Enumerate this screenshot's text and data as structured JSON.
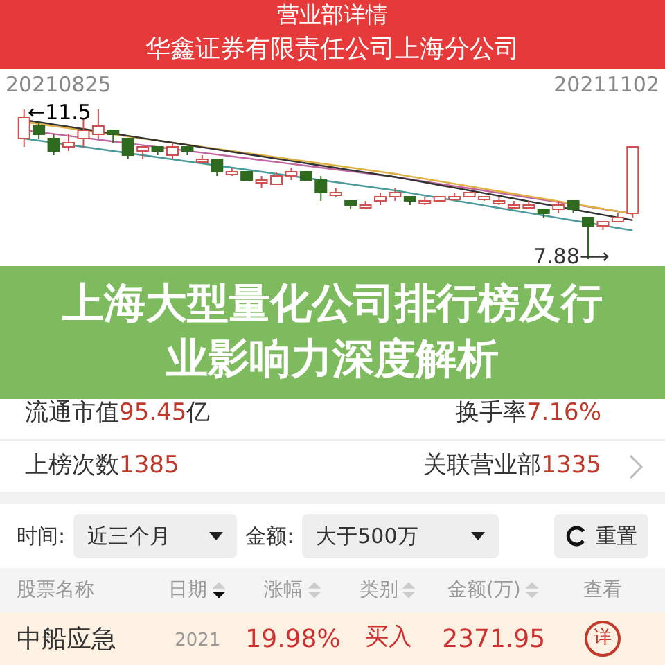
{
  "header": {
    "title": "营业部详情",
    "subtitle": "华鑫证券有限责任公司上海分公司"
  },
  "chart": {
    "start_date": "20210825",
    "end_date": "20211102",
    "high_label": "←11.5",
    "low_label": "7.88⟶"
  },
  "banner": {
    "title": "上海大型量化公司排行榜及行业影响力深度解析"
  },
  "stats": [
    {
      "label": "流通市值",
      "value": "95.45",
      "unit": "亿",
      "label_2": "换手率",
      "value_2": "7.16%",
      "link": false
    },
    {
      "label": "上榜次数",
      "value": "1385",
      "label_2": "关联营业部",
      "value_2": "1335",
      "link": true
    }
  ],
  "filters": [
    {
      "label": "时间:",
      "value": "近三个月"
    },
    {
      "label": "金额:",
      "value": "大于500万"
    }
  ],
  "reset_button": "重置",
  "table": {
    "columns": [
      {
        "label": "股票名称",
        "sortable": false
      },
      {
        "label": "日期",
        "sortable": true,
        "sorted_desc": true
      },
      {
        "label": "涨幅",
        "sortable": true,
        "sorted_desc": false
      },
      {
        "label": "类别",
        "sortable": true,
        "sorted_desc": false
      },
      {
        "label": "金额(万)",
        "sortable": true,
        "sorted_desc": false
      },
      {
        "label": "查看",
        "sortable": false
      }
    ],
    "rows": [
      {
        "name": "中船应急",
        "date": "2021",
        "change": "19.98%",
        "type": "买入",
        "amount": "2371.95",
        "view": "详"
      }
    ]
  }
}
